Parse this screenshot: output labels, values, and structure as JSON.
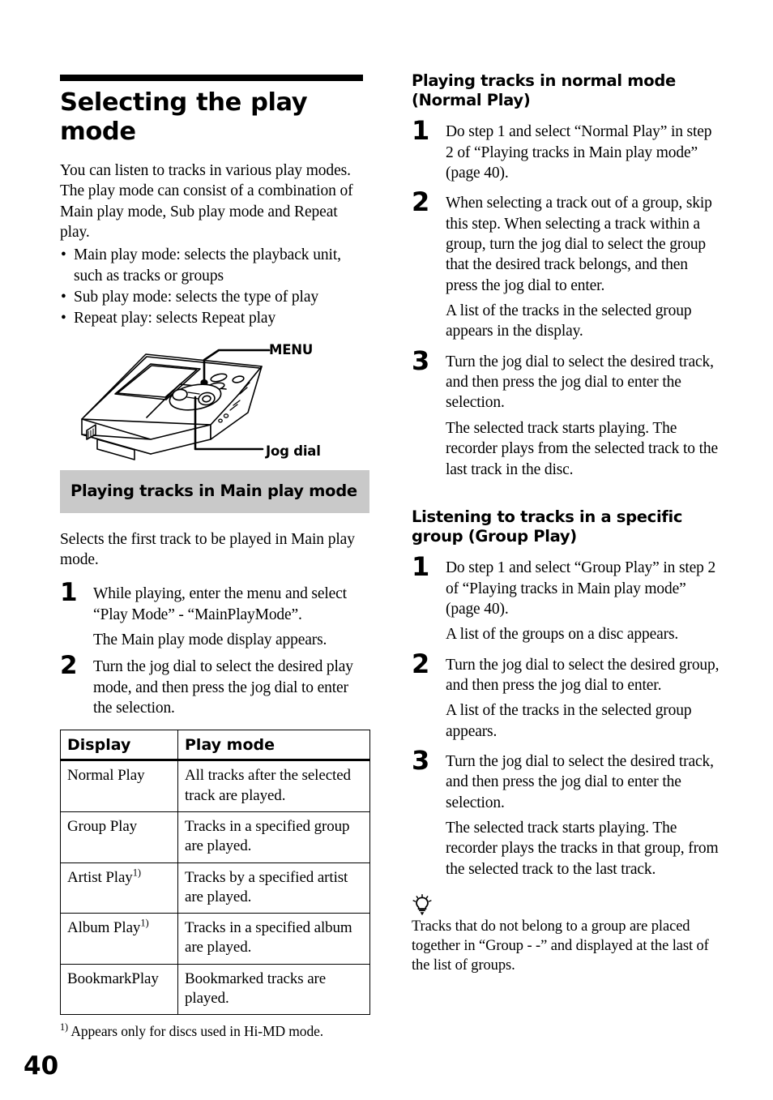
{
  "page_number": "40",
  "left_column": {
    "title": "Selecting the play mode",
    "intro": "You can listen to tracks in various play modes. The play mode can consist of a combination of Main play mode, Sub play mode and Repeat play.",
    "bullets": [
      "Main play mode: selects the playback unit, such as tracks or groups",
      "Sub play mode: selects the type of play",
      "Repeat play: selects Repeat play"
    ],
    "figure": {
      "name": "minidisc-recorder-illustration",
      "callouts": [
        {
          "label": "MENU",
          "icon": "leader-line"
        },
        {
          "label": "Jog dial",
          "icon": "leader-line"
        }
      ]
    },
    "section_heading": "Playing tracks in Main play mode",
    "section_intro": "Selects the first track to be played in Main play mode.",
    "steps": [
      {
        "number": "1",
        "paragraphs": [
          "While playing, enter the menu and select “Play Mode” - “MainPlayMode”.",
          "The Main play mode display appears."
        ]
      },
      {
        "number": "2",
        "paragraphs": [
          "Turn the jog dial to select the desired play mode, and then press the jog dial to enter the selection."
        ]
      }
    ],
    "table": {
      "headers": [
        "Display",
        "Play mode"
      ],
      "rows": [
        {
          "display": "Normal Play",
          "footnote": "",
          "mode": "All tracks after the selected track are played."
        },
        {
          "display": "Group Play",
          "footnote": "",
          "mode": "Tracks in a specified group are played."
        },
        {
          "display": "Artist Play",
          "footnote": "1)",
          "mode": "Tracks by a specified artist are played."
        },
        {
          "display": "Album Play",
          "footnote": "1)",
          "mode": "Tracks in a specified album are played."
        },
        {
          "display": "BookmarkPlay",
          "footnote": "",
          "mode": "Bookmarked tracks are played."
        }
      ]
    },
    "footnote_marker": "1)",
    "footnote_text": " Appears only for discs used in Hi-MD mode."
  },
  "right_column": {
    "heading_normal": "Playing tracks in normal mode (Normal Play)",
    "normal_steps": [
      {
        "number": "1",
        "paragraphs": [
          "Do step 1 and select “Normal Play” in step 2 of “Playing tracks in Main play mode” (page 40)."
        ]
      },
      {
        "number": "2",
        "paragraphs": [
          "When selecting a track out of a group, skip this step. When selecting a track within a group, turn the jog dial to select the group that the desired track belongs, and then press the jog dial to enter.",
          "A list of the tracks in the selected group appears in the display."
        ]
      },
      {
        "number": "3",
        "paragraphs": [
          "Turn the jog dial to select the desired track, and then press the jog dial to enter the selection.",
          "The selected track starts playing. The recorder plays from the selected track to the last track in the disc."
        ]
      }
    ],
    "heading_group": "Listening to tracks in a specific group (Group Play)",
    "group_steps": [
      {
        "number": "1",
        "paragraphs": [
          "Do step 1 and select “Group Play” in step 2 of “Playing tracks in Main play mode” (page 40).",
          "A list of the groups on a disc appears."
        ]
      },
      {
        "number": "2",
        "paragraphs": [
          "Turn the jog dial to select the desired group, and then press the jog dial to enter.",
          "A list of the tracks in the selected group appears."
        ]
      },
      {
        "number": "3",
        "paragraphs": [
          "Turn the jog dial to select the desired track, and then press the jog dial to enter the selection.",
          "The selected track starts playing. The recorder plays the tracks in that group, from the selected track to the last track."
        ]
      }
    ],
    "tip": {
      "icon": "lightbulb-tip-icon",
      "text": "Tracks that do not belong to a group are placed together in “Group - -” and displayed at the last of the list of groups."
    }
  }
}
